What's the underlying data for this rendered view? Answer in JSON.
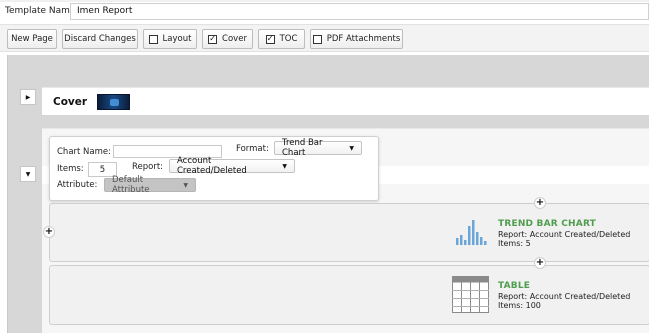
{
  "header": {
    "template_name_label": "Template Name:",
    "template_name_value": "Imen Report"
  },
  "toolbar": {
    "new_page": "New Page",
    "discard_changes": "Discard Changes",
    "layout": {
      "label": "Layout",
      "checked": false
    },
    "cover": {
      "label": "Cover",
      "checked": true
    },
    "toc": {
      "label": "TOC",
      "checked": true
    },
    "pdf_attachments": {
      "label": "PDF Attachments",
      "checked": false
    }
  },
  "cover_section": {
    "title": "Cover",
    "expand_icon": "caret-right-icon"
  },
  "chart_editor": {
    "chart_name_label": "Chart Name:",
    "chart_name_value": "",
    "format_label": "Format:",
    "format_value": "Trend Bar Chart",
    "items_label": "Items:",
    "items_value": "5",
    "report_label": "Report:",
    "report_value": "Account Created/Deleted",
    "attribute_label": "Attribute:",
    "attribute_value": "Default Attribute",
    "collapse_icon": "caret-down-icon"
  },
  "charts": [
    {
      "title": "TREND BAR CHART",
      "report": "Report: Account Created/Deleted",
      "items": "Items: 5",
      "icon": "trend-bar-chart-icon"
    },
    {
      "title": "TABLE",
      "report": "Report: Account Created/Deleted",
      "items": "Items: 100",
      "icon": "table-icon"
    }
  ],
  "colors": {
    "chart_title": "#4f9d4f",
    "canvas_bg": "#d7d7d7",
    "chart_icon_blue": "#6aa6d8",
    "table_icon_gray": "#8a8a8a"
  }
}
